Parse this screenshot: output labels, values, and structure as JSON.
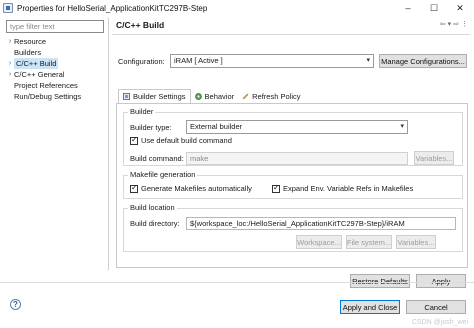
{
  "window": {
    "title": "Properties for HelloSerial_ApplicationKitTC297B-Step",
    "minimize": "–",
    "maximize": "☐",
    "close": "✕"
  },
  "left": {
    "filter_placeholder": "type filter text",
    "tree": [
      {
        "label": "Resource",
        "expandable": true
      },
      {
        "label": "Builders",
        "expandable": false
      },
      {
        "label": "C/C++ Build",
        "expandable": true,
        "selected": true
      },
      {
        "label": "C/C++ General",
        "expandable": true
      },
      {
        "label": "Project References",
        "expandable": false
      },
      {
        "label": "Run/Debug Settings",
        "expandable": false
      }
    ]
  },
  "page": {
    "title": "C/C++ Build",
    "configuration_label": "Configuration:",
    "configuration_value": "iRAM  [ Active ]",
    "manage_button": "Manage Configurations...",
    "tabs": [
      {
        "label": "Builder Settings",
        "icon": "builder-icon",
        "active": true
      },
      {
        "label": "Behavior",
        "icon": "behavior-icon",
        "active": false
      },
      {
        "label": "Refresh Policy",
        "icon": "refresh-icon",
        "active": false
      }
    ],
    "builder_group": {
      "title": "Builder",
      "type_label": "Builder type:",
      "type_value": "External builder",
      "use_default_label": "Use default build command",
      "use_default_checked": true,
      "build_command_label": "Build command:",
      "build_command_value": "make",
      "variables_button": "Variables..."
    },
    "makefile_group": {
      "title": "Makefile generation",
      "generate_label": "Generate Makefiles automatically",
      "generate_checked": true,
      "expand_label": "Expand Env. Variable Refs in Makefiles",
      "expand_checked": true
    },
    "location_group": {
      "title": "Build location",
      "directory_label": "Build directory:",
      "directory_value": "${workspace_loc:/HelloSerial_ApplicationKitTC297B-Step}/iRAM",
      "workspace_button": "Workspace...",
      "filesystem_button": "File system...",
      "variables_button": "Variables..."
    },
    "restore_defaults": "Restore Defaults",
    "apply": "Apply"
  },
  "footer": {
    "apply_close": "Apply and Close",
    "cancel": "Cancel",
    "watermark": "CSDN @josh_wei"
  }
}
